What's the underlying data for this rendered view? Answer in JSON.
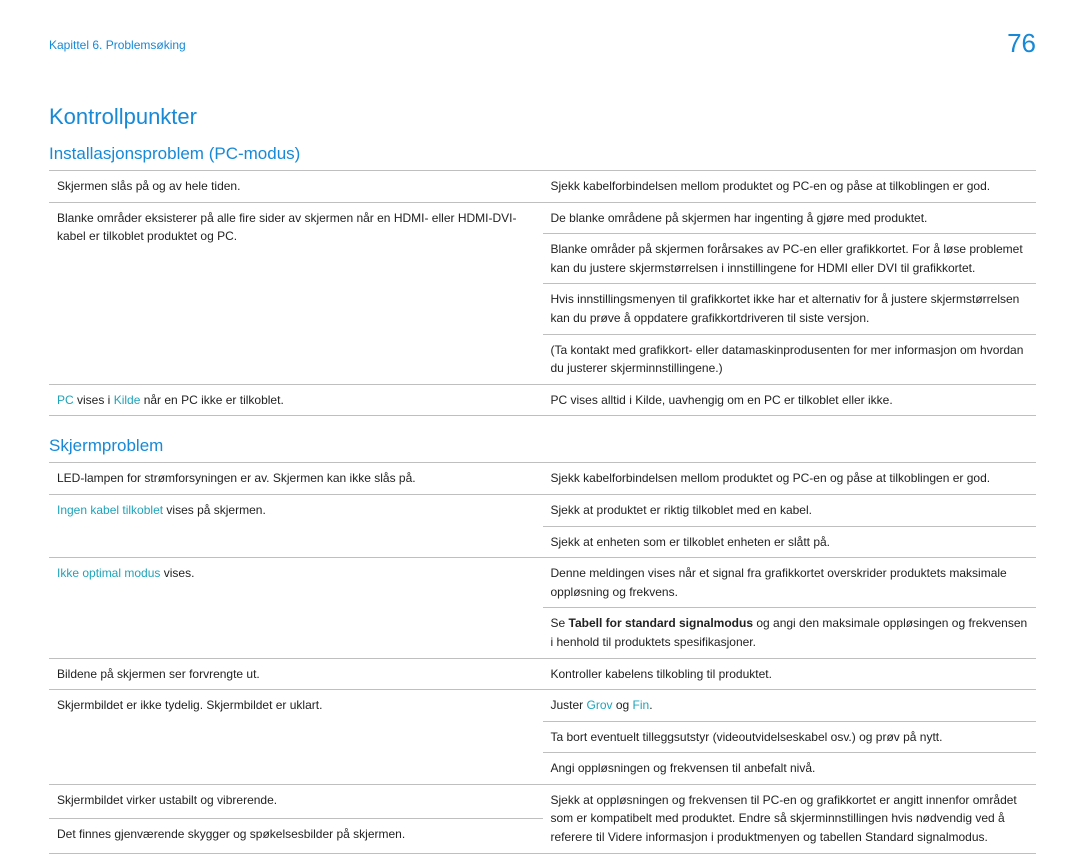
{
  "breadcrumb": "Kapittel 6. Problemsøking",
  "page_number": "76",
  "main_heading": "Kontrollpunkter",
  "section1": {
    "heading": "Installasjonsproblem (PC-modus)",
    "rows": {
      "r1c1": "Skjermen slås på og av hele tiden.",
      "r1c2": "Sjekk kabelforbindelsen mellom produktet og PC-en og påse at tilkoblingen er god.",
      "r2c1": "Blanke områder eksisterer på alle fire sider av skjermen når en HDMI- eller HDMI-DVI-kabel er tilkoblet produktet og PC.",
      "r2c2a": "De blanke områdene på skjermen har ingenting å gjøre med produktet.",
      "r2c2b": "Blanke områder på skjermen forårsakes av PC-en eller grafikkortet. For å løse problemet kan du justere skjermstørrelsen i innstillingene for HDMI eller DVI til grafikkortet.",
      "r2c2c": "Hvis innstillingsmenyen til grafikkortet ikke har et alternativ for å justere skjermstørrelsen kan du prøve å oppdatere grafikkortdriveren til siste versjon.",
      "r2c2d": "(Ta kontakt med grafikkort- eller datamaskinprodusenten for mer informasjon om hvordan du justerer skjerminnstillingene.)",
      "r3c1_accent1": "PC",
      "r3c1_mid": " vises i ",
      "r3c1_accent2": "Kilde",
      "r3c1_tail": " når en PC ikke er tilkoblet.",
      "r3c2": "PC vises alltid i Kilde, uavhengig om en PC er tilkoblet eller ikke."
    }
  },
  "section2": {
    "heading": "Skjermproblem",
    "rows": {
      "r1c1": "LED-lampen for strømforsyningen er av. Skjermen kan ikke slås på.",
      "r1c2": "Sjekk kabelforbindelsen mellom produktet og PC-en og påse at tilkoblingen er god.",
      "r2c1_accent": "Ingen kabel tilkoblet",
      "r2c1_tail": " vises på skjermen.",
      "r2c2a": "Sjekk at produktet er riktig tilkoblet med en kabel.",
      "r2c2b": "Sjekk at enheten som er tilkoblet enheten er slått på.",
      "r3c1_accent": "Ikke optimal modus",
      "r3c1_tail": " vises.",
      "r3c2a": "Denne meldingen vises når et signal fra grafikkortet overskrider produktets maksimale oppløsning og frekvens.",
      "r3c2b_pre": "Se ",
      "r3c2b_bold": "Tabell for standard signalmodus",
      "r3c2b_post": " og angi den maksimale oppløsingen og frekvensen i henhold til produktets spesifikasjoner.",
      "r4c1": "Bildene på skjermen ser forvrengte ut.",
      "r4c2": "Kontroller kabelens tilkobling til produktet.",
      "r5c1": "Skjermbildet er ikke tydelig. Skjermbildet er uklart.",
      "r5c2a_pre": "Juster ",
      "r5c2a_a1": "Grov",
      "r5c2a_mid": " og ",
      "r5c2a_a2": "Fin",
      "r5c2a_post": ".",
      "r5c2b": "Ta bort eventuelt tilleggsutstyr (videoutvidelseskabel osv.) og prøv på nytt.",
      "r5c2c": "Angi oppløsningen og frekvensen til anbefalt nivå.",
      "r6c1": "Skjermbildet virker ustabilt og vibrerende.",
      "r6c2": "Sjekk at oppløsningen og frekvensen til PC-en og grafikkortet er angitt innenfor området som er kompatibelt med produktet. Endre så skjerminnstillingen hvis nødvendig ved å referere til Videre informasjon i produktmenyen og tabellen Standard signalmodus.",
      "r7c1": "Det finnes gjenværende skygger og spøkelsesbilder på skjermen."
    }
  }
}
